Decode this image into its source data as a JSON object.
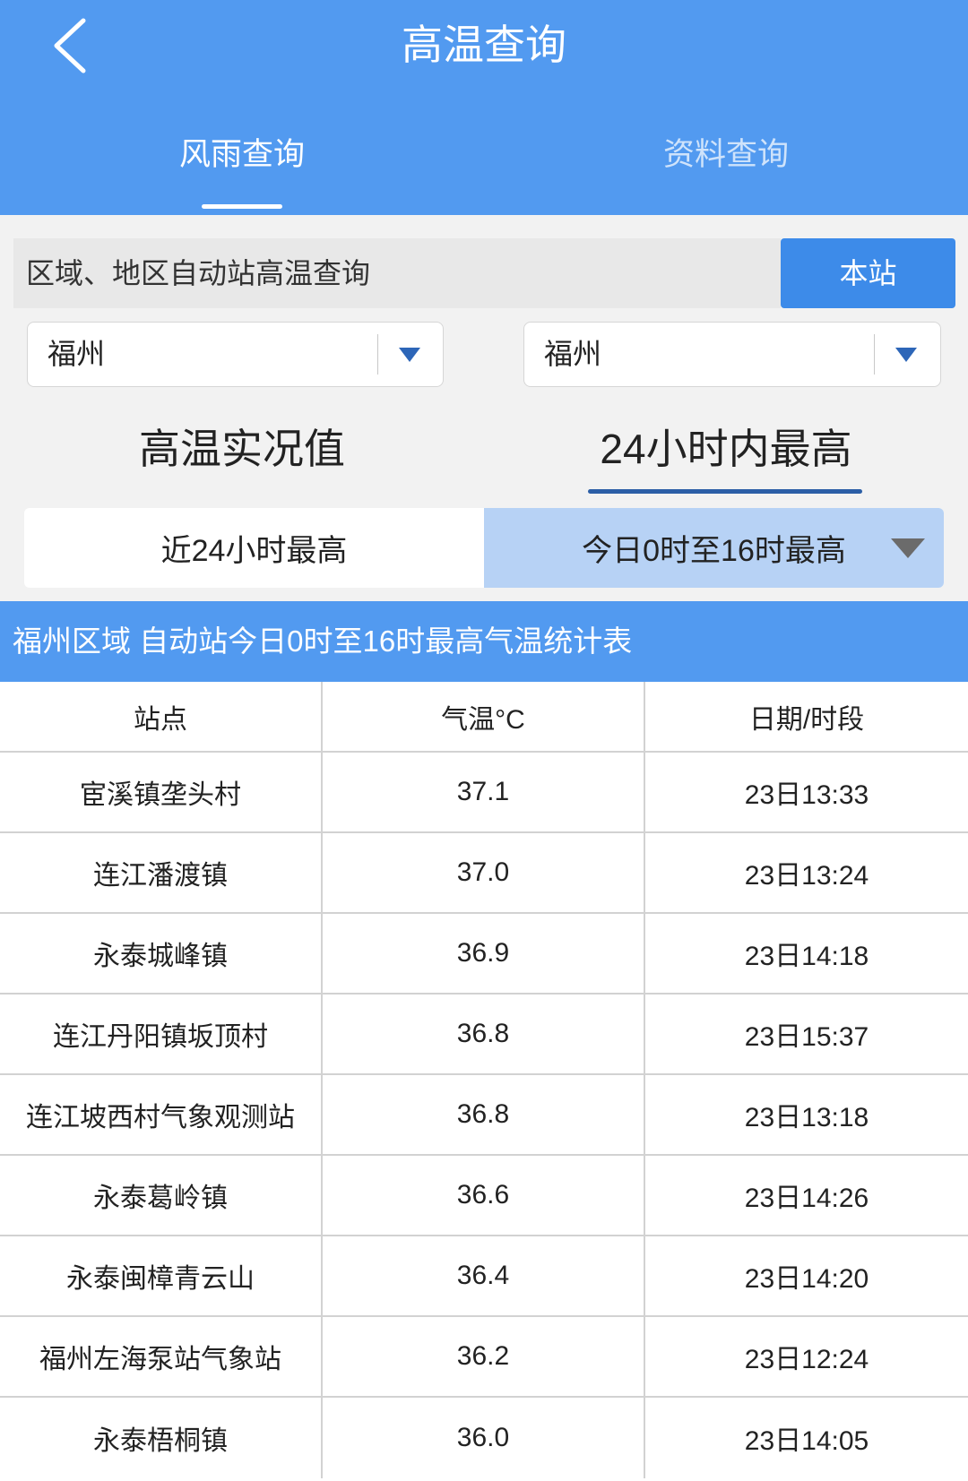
{
  "header": {
    "title": "高温查询",
    "back_icon": "chevron-left-icon"
  },
  "tabs": [
    {
      "label": "风雨查询",
      "active": true
    },
    {
      "label": "资料查询",
      "active": false
    }
  ],
  "search": {
    "label": "区域、地区自动站高温查询",
    "button": "本站"
  },
  "dropdowns": [
    {
      "value": "福州",
      "icon": "triangle-down-icon"
    },
    {
      "value": "福州",
      "icon": "triangle-down-icon"
    }
  ],
  "mode_tabs": [
    {
      "label": "高温实况值",
      "active": false
    },
    {
      "label": "24小时内最高",
      "active": true
    }
  ],
  "range_tabs": [
    {
      "label": "近24小时最高",
      "active": false
    },
    {
      "label": "今日0时至16时最高",
      "active": true,
      "icon": "triangle-down-icon"
    }
  ],
  "banner": "福州区域 自动站今日0时至16时最高气温统计表",
  "table": {
    "headers": [
      "站点",
      "气温°C",
      "日期/时段"
    ],
    "rows": [
      {
        "station": "宦溪镇垄头村",
        "temp": "37.1",
        "time": "23日13:33"
      },
      {
        "station": "连江潘渡镇",
        "temp": "37.0",
        "time": "23日13:24"
      },
      {
        "station": "永泰城峰镇",
        "temp": "36.9",
        "time": "23日14:18"
      },
      {
        "station": "连江丹阳镇坂顶村",
        "temp": "36.8",
        "time": "23日15:37"
      },
      {
        "station": "连江坡西村气象观测站",
        "temp": "36.8",
        "time": "23日13:18"
      },
      {
        "station": "永泰葛岭镇",
        "temp": "36.6",
        "time": "23日14:26"
      },
      {
        "station": "永泰闽樟青云山",
        "temp": "36.4",
        "time": "23日14:20"
      },
      {
        "station": "福州左海泵站气象站",
        "temp": "36.2",
        "time": "23日12:24"
      },
      {
        "station": "永泰梧桐镇",
        "temp": "36.0",
        "time": "23日14:05"
      }
    ]
  },
  "colors": {
    "primary": "#529af0",
    "button": "#3d8be9",
    "underline": "#2b5ea6",
    "range-bg": "#b7d2f5",
    "arrow": "#2d66b8"
  }
}
